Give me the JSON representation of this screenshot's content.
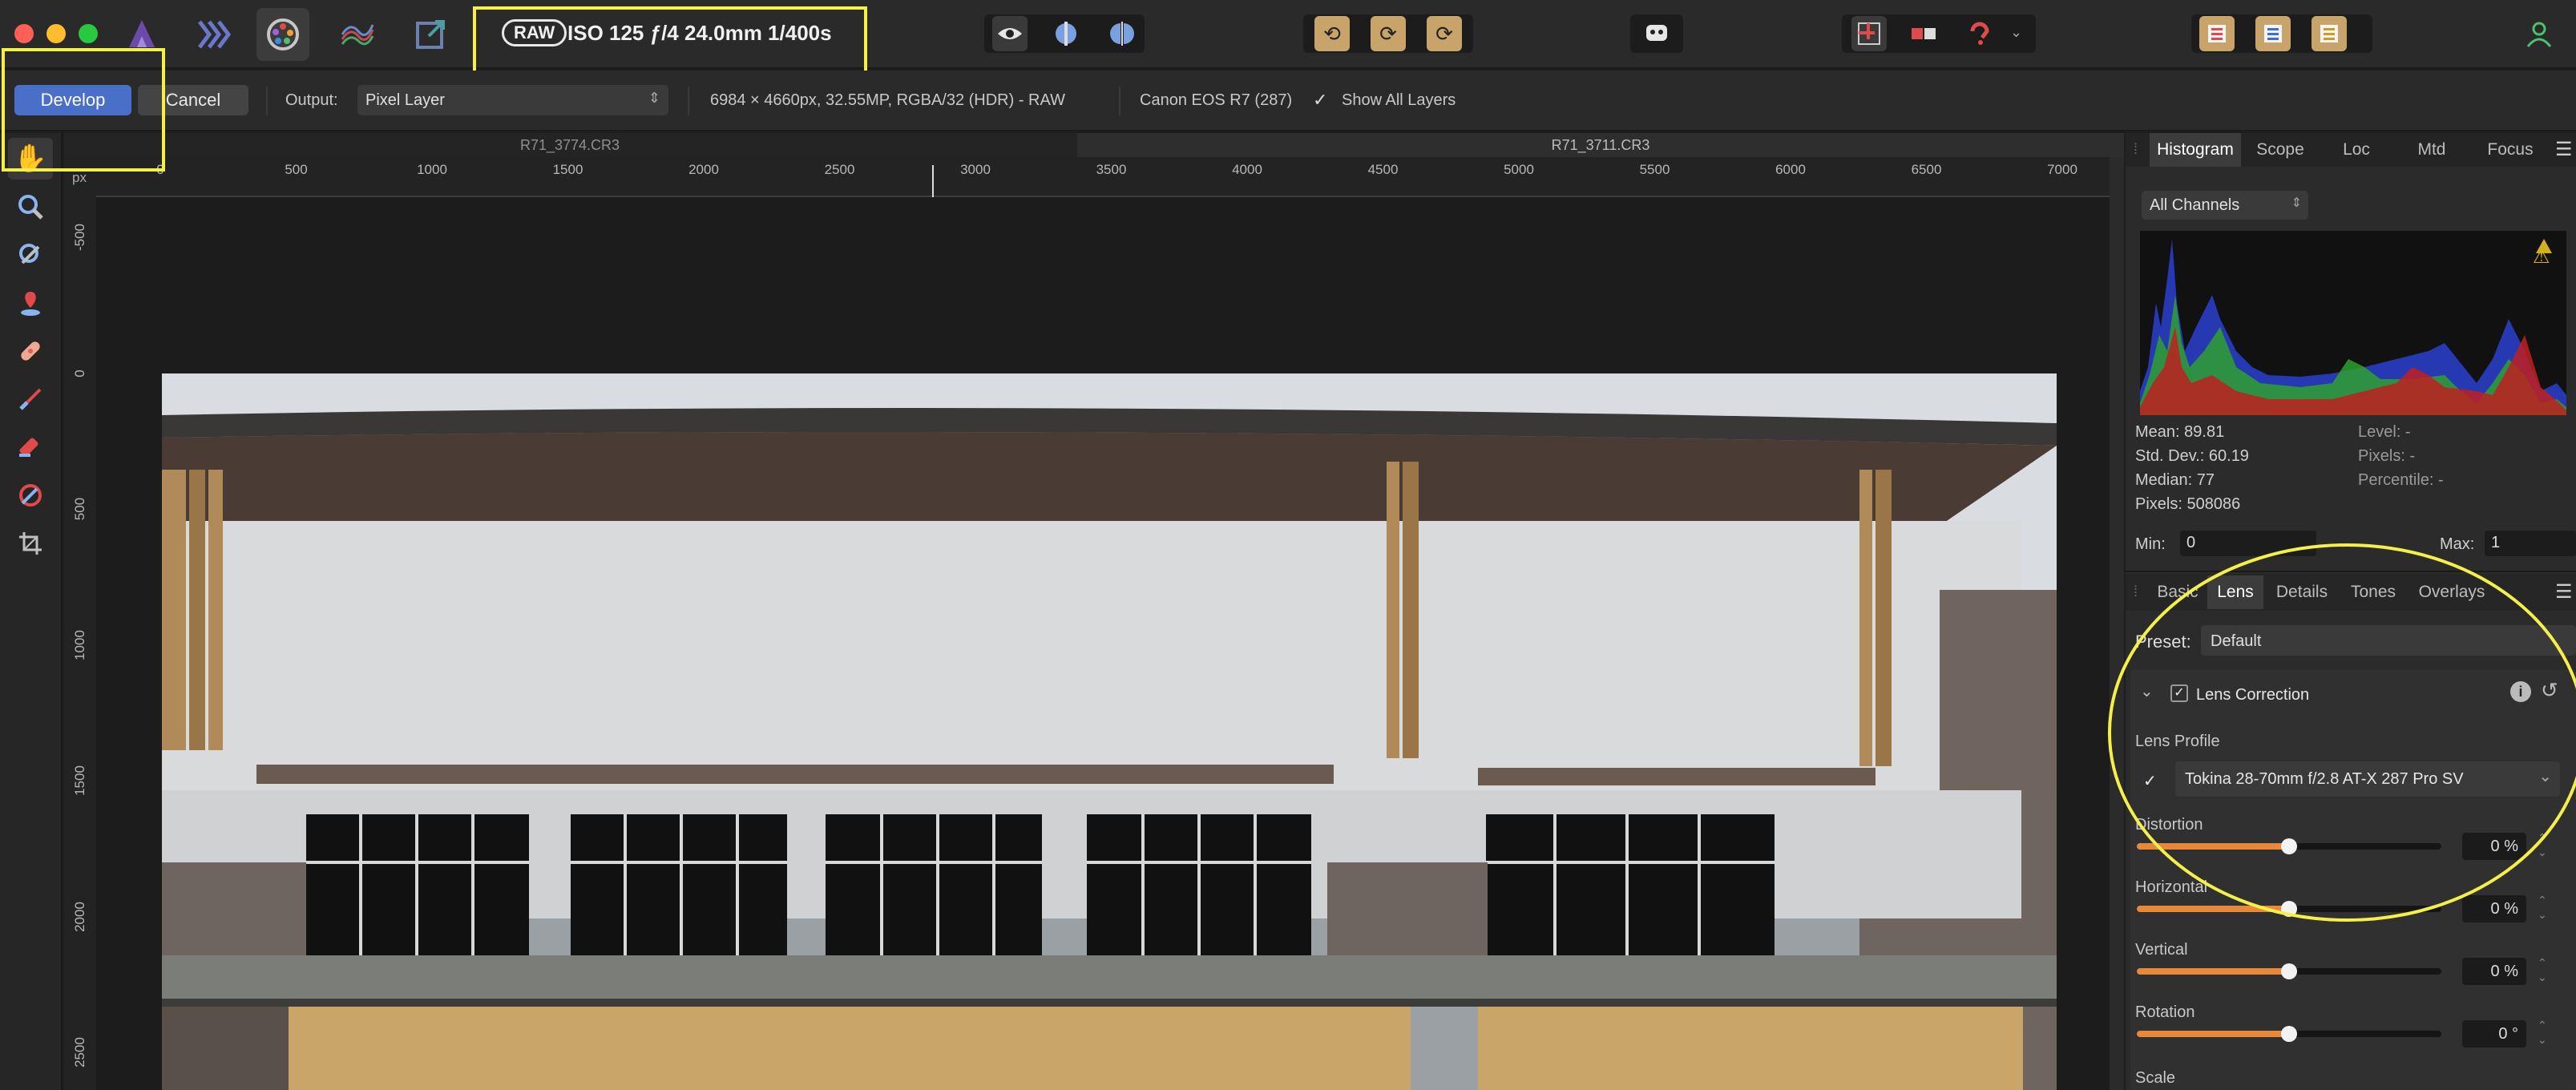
{
  "toolbar_top": {
    "raw_badge": "RAW",
    "exif": "ISO 125 ƒ/4 24.0mm 1/400s"
  },
  "context": {
    "develop_label": "Develop",
    "cancel_label": "Cancel",
    "output_label": "Output:",
    "output_value": "Pixel Layer",
    "image_info": "6984 × 4660px, 32.55MP, RGBA/32 (HDR) - RAW",
    "camera": "Canon EOS R7 (287)",
    "show_all_layers": "Show All Layers"
  },
  "doc_tabs": [
    "R71_3774.CR3",
    "R71_3711.CR3"
  ],
  "ruler": {
    "unit": "px",
    "h_labels": [
      "0",
      "500",
      "1000",
      "1500",
      "2000",
      "2500",
      "3000",
      "3500",
      "4000",
      "4500",
      "5000",
      "5500",
      "6000",
      "6500",
      "7000"
    ],
    "v_labels": [
      "-500",
      "0",
      "500",
      "1000",
      "1500",
      "2000",
      "2500"
    ]
  },
  "studio_tabs": [
    "Histogram",
    "Scope",
    "Loc",
    "Mtd",
    "Focus"
  ],
  "histogram": {
    "channel": "All Channels",
    "mean": "Mean: 89.81",
    "std": "Std. Dev.: 60.19",
    "median": "Median: 77",
    "pixels": "Pixels: 508086",
    "level": "Level: -",
    "pixels_r": "Pixels: -",
    "percentile": "Percentile: -",
    "min_label": "Min:",
    "min_value": "0",
    "max_label": "Max:",
    "max_value": "1"
  },
  "develop_tabs": [
    "Basic",
    "Lens",
    "Details",
    "Tones",
    "Overlays"
  ],
  "lens": {
    "preset_label": "Preset:",
    "preset_value": "Default",
    "section_title": "Lens Correction",
    "profile_label": "Lens Profile",
    "profile_value": "Tokina 28-70mm f/2.8 AT-X 287 Pro SV",
    "sliders": [
      {
        "label": "Distortion",
        "value": "0 %",
        "level": 0.5
      },
      {
        "label": "Horizontal",
        "value": "0 %",
        "level": 0.5
      },
      {
        "label": "Vertical",
        "value": "0 %",
        "level": 0.5
      },
      {
        "label": "Rotation",
        "value": "0 °",
        "level": 0.5
      }
    ],
    "scale_label": "Scale"
  },
  "colors": {
    "accent": "#4a6fc9",
    "annotation": "#f4f04a",
    "slider": "#e8883a"
  }
}
